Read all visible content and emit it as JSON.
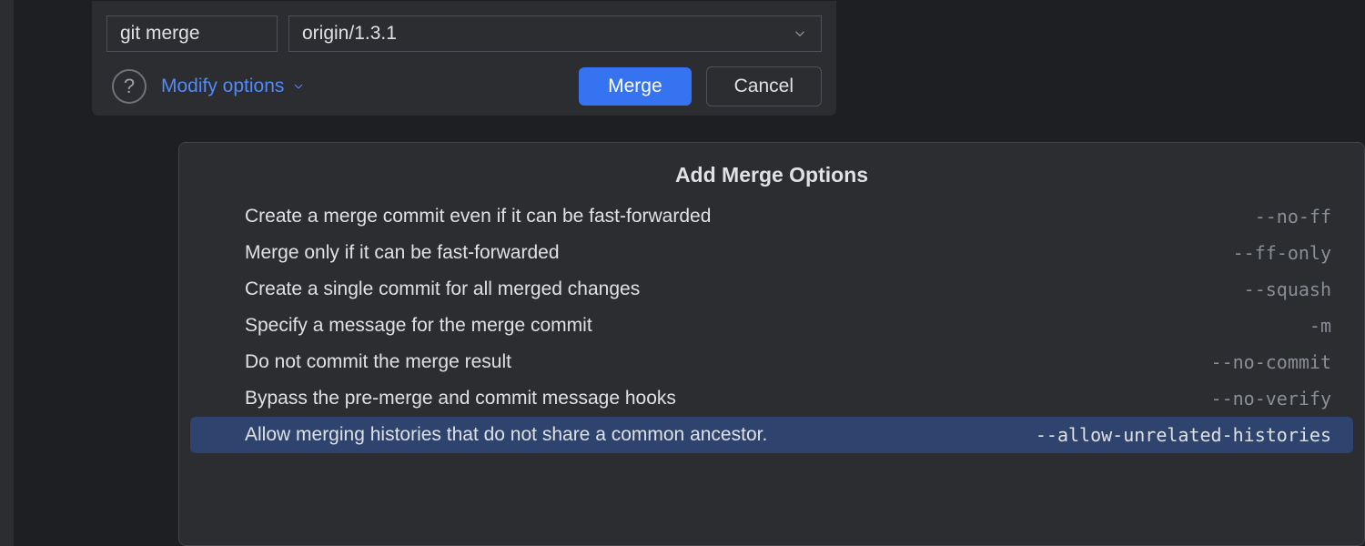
{
  "dialog": {
    "command": "git merge",
    "branch": "origin/1.3.1",
    "modify_label": "Modify options",
    "merge_label": "Merge",
    "cancel_label": "Cancel"
  },
  "popup": {
    "title": "Add Merge Options",
    "options": [
      {
        "desc": "Create a merge commit even if it can be fast-forwarded",
        "flag": "--no-ff",
        "selected": false
      },
      {
        "desc": "Merge only if it can be fast-forwarded",
        "flag": "--ff-only",
        "selected": false
      },
      {
        "desc": "Create a single commit for all merged changes",
        "flag": "--squash",
        "selected": false
      },
      {
        "desc": "Specify a message for the merge commit",
        "flag": "-m",
        "selected": false
      },
      {
        "desc": "Do not commit the merge result",
        "flag": "--no-commit",
        "selected": false
      },
      {
        "desc": "Bypass the pre-merge and commit message hooks",
        "flag": "--no-verify",
        "selected": false
      },
      {
        "desc": "Allow merging histories that do not share a common ancestor.",
        "flag": "--allow-unrelated-histories",
        "selected": true
      }
    ]
  }
}
